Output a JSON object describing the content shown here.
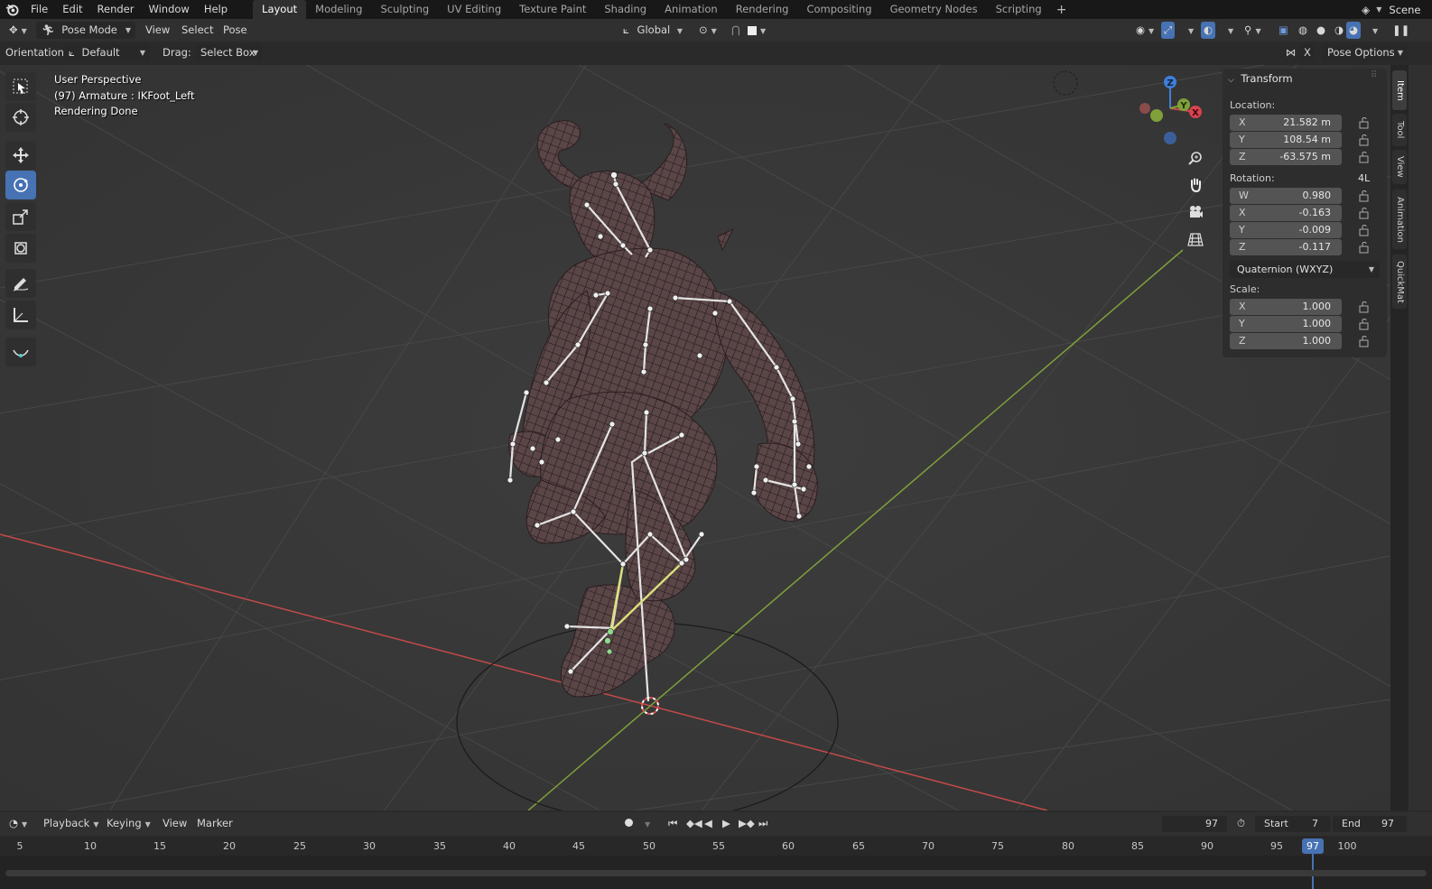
{
  "menu": {
    "items": [
      "File",
      "Edit",
      "Render",
      "Window",
      "Help"
    ],
    "scene_label": "Scene"
  },
  "workspaces": [
    "Layout",
    "Modeling",
    "Sculpting",
    "UV Editing",
    "Texture Paint",
    "Shading",
    "Animation",
    "Rendering",
    "Compositing",
    "Geometry Nodes",
    "Scripting"
  ],
  "header": {
    "mode": "Pose Mode",
    "view": "View",
    "select": "Select",
    "pose": "Pose",
    "transform_orientation": "Global"
  },
  "toolsettings": {
    "orientation_label": "Orientation:",
    "orientation_value": "Default",
    "drag_label": "Drag:",
    "drag_value": "Select Box",
    "x_label": "X",
    "pose_options": "Pose Options"
  },
  "overlay": {
    "line1": "User Perspective",
    "line2": "(97) Armature : IKFoot_Left",
    "line3": "Rendering Done"
  },
  "gizmo": {
    "z": "Z",
    "y": "Y",
    "x": "X"
  },
  "transform_panel": {
    "title": "Transform",
    "location_label": "Location:",
    "location": [
      {
        "axis": "X",
        "value": "21.582 m"
      },
      {
        "axis": "Y",
        "value": "108.54 m"
      },
      {
        "axis": "Z",
        "value": "-63.575 m"
      }
    ],
    "rotation_label": "Rotation:",
    "rotation_lock_label": "4L",
    "rotation": [
      {
        "axis": "W",
        "value": "0.980"
      },
      {
        "axis": "X",
        "value": "-0.163"
      },
      {
        "axis": "Y",
        "value": "-0.009"
      },
      {
        "axis": "Z",
        "value": "-0.117"
      }
    ],
    "rotation_mode": "Quaternion (WXYZ)",
    "scale_label": "Scale:",
    "scale": [
      {
        "axis": "X",
        "value": "1.000"
      },
      {
        "axis": "Y",
        "value": "1.000"
      },
      {
        "axis": "Z",
        "value": "1.000"
      }
    ]
  },
  "side_tabs": [
    "Item",
    "Tool",
    "View",
    "Animation",
    "QuickMat"
  ],
  "timeline": {
    "playback": "Playback",
    "keying": "Keying",
    "view": "View",
    "marker": "Marker",
    "current_frame": "97",
    "start_label": "Start",
    "start_value": "7",
    "end_label": "End",
    "end_value": "97",
    "ruler": [
      "5",
      "10",
      "15",
      "20",
      "25",
      "30",
      "35",
      "40",
      "45",
      "50",
      "55",
      "60",
      "65",
      "70",
      "75",
      "80",
      "85",
      "90",
      "95",
      "97",
      "100"
    ]
  },
  "colors": {
    "active_blue": "#4772b3",
    "x_axis": "#c74a4a",
    "y_axis": "#7fa03a",
    "z_axis": "#3f7fd9"
  }
}
